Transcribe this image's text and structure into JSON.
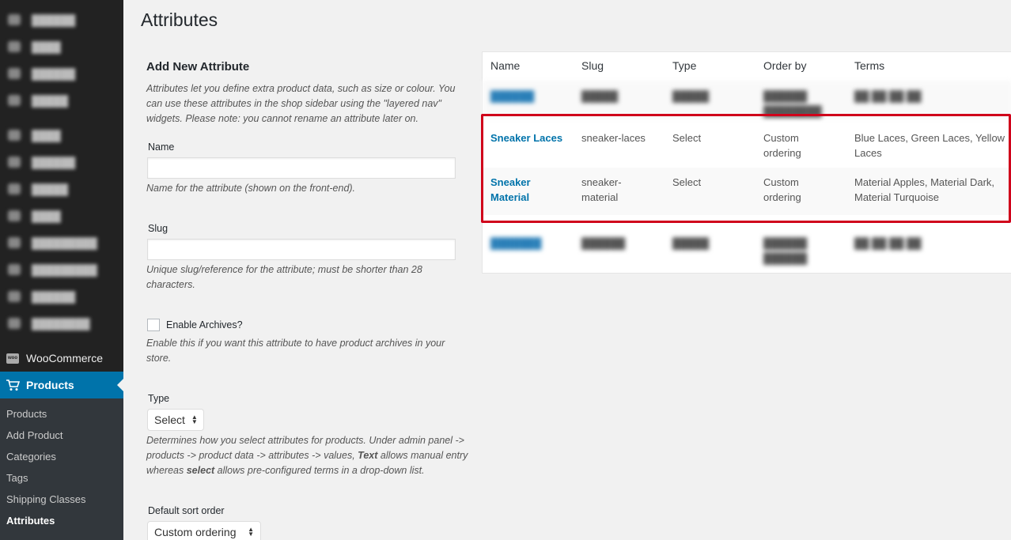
{
  "sidebar": {
    "woocommerce_label": "WooCommerce",
    "products_label": "Products",
    "submenu": [
      "Products",
      "Add Product",
      "Categories",
      "Tags",
      "Shipping Classes",
      "Attributes"
    ],
    "current_submenu": "Attributes",
    "accent_color": "#0073aa"
  },
  "page": {
    "title": "Attributes"
  },
  "form": {
    "heading": "Add New Attribute",
    "intro": "Attributes let you define extra product data, such as size or colour. You can use these attributes in the shop sidebar using the \"layered nav\" widgets. Please note: you cannot rename an attribute later on.",
    "name_label": "Name",
    "name_value": "",
    "name_desc": "Name for the attribute (shown on the front-end).",
    "slug_label": "Slug",
    "slug_value": "",
    "slug_desc": "Unique slug/reference for the attribute; must be shorter than 28 characters.",
    "archives_label": "Enable Archives?",
    "archives_checked": false,
    "archives_desc": "Enable this if you want this attribute to have product archives in your store.",
    "type_label": "Type",
    "type_value": "Select",
    "type_desc_1": "Determines how you select attributes for products. Under admin panel -> products -> product data -> attributes -> values, ",
    "type_desc_text": "Text",
    "type_desc_2": " allows manual entry whereas ",
    "type_desc_select": "select",
    "type_desc_3": " allows pre-configured terms in a drop-down list.",
    "sort_label": "Default sort order",
    "sort_value": "Custom ordering"
  },
  "table": {
    "headers": [
      "Name",
      "Slug",
      "Type",
      "Order by",
      "Terms"
    ],
    "rows": [
      {
        "name": "Sneaker Laces",
        "slug": "sneaker-laces",
        "type": "Select",
        "order_by": "Custom ordering",
        "terms": "Blue Laces, Green Laces, Yellow Laces"
      },
      {
        "name": "Sneaker Material",
        "slug": "sneaker-material",
        "type": "Select",
        "order_by": "Custom ordering",
        "terms": "Material Apples, Material Dark, Material Turquoise"
      }
    ],
    "highlight_color": "#d0021b"
  }
}
